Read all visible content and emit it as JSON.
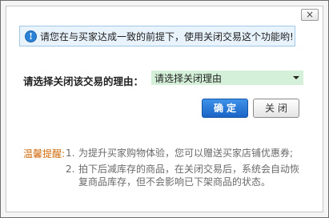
{
  "dialog": {
    "close_label": "×"
  },
  "notice": {
    "icon": "info-icon",
    "icon_glyph": "!",
    "text": "请您在与买家达成一致的前提下，使用关闭交易这个功能哟!"
  },
  "reason": {
    "label": "请选择关闭该交易的理由：",
    "selected": "请选择关闭理由"
  },
  "buttons": {
    "confirm": "确定",
    "cancel": "关闭"
  },
  "tips": {
    "label": "温馨提醒:",
    "items": [
      {
        "num": "1.",
        "text": "为提升买家购物体验，您可以赠送买家店铺优惠券;"
      },
      {
        "num": "2.",
        "text": "拍下后减库存的商品，在关闭交易后，系统会自动恢复商品库存，但不会影响已下架商品的状态。"
      }
    ]
  },
  "colors": {
    "primary_button": "#1a64c6",
    "notice_bg": "#e8f3fc",
    "select_bg": "#d5f0d8",
    "tips_label": "#d06a0c"
  }
}
